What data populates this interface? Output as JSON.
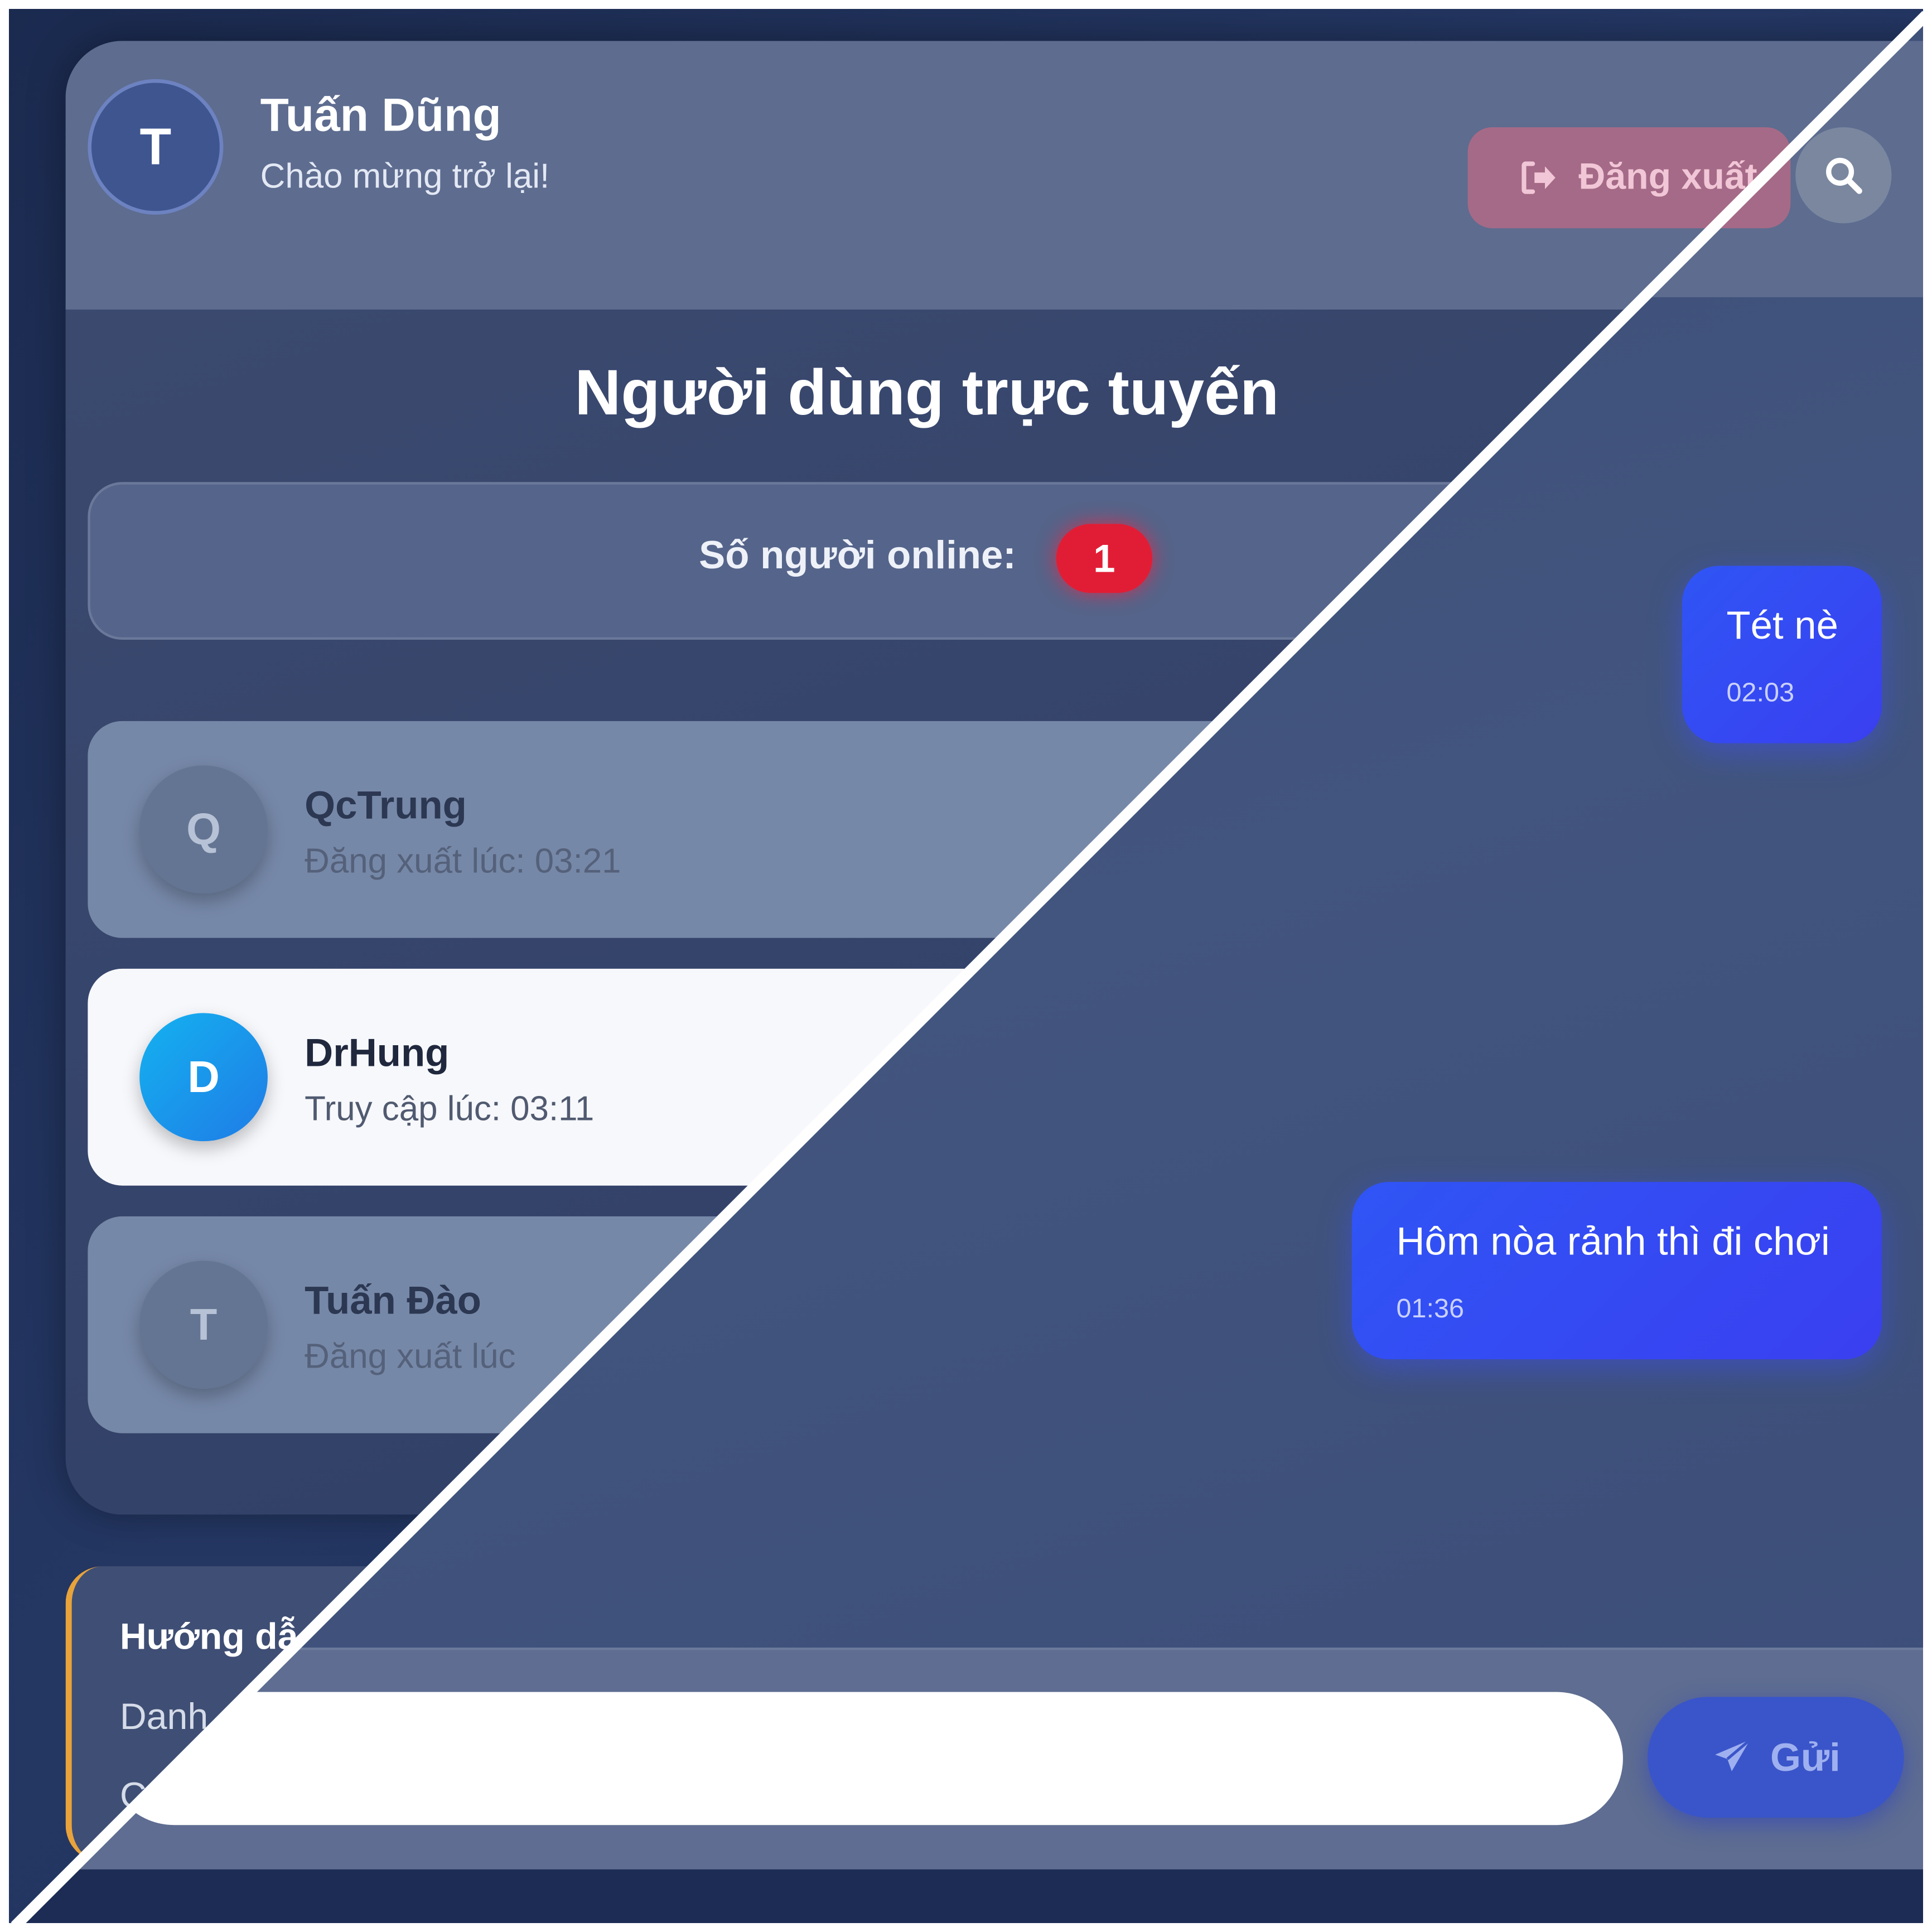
{
  "header": {
    "user_initial": "T",
    "user_name": "Tuấn Dũng",
    "greeting": "Chào mừng trở lại!",
    "logout_label": "Đăng xuất"
  },
  "online": {
    "title": "Người dùng trực tuyến",
    "count_label": "Số người online:",
    "count": "1"
  },
  "users": [
    {
      "initial": "Q",
      "name": "QcTrung",
      "status": "Đăng xuất lúc: 03:21",
      "active": false
    },
    {
      "initial": "D",
      "name": "DrHung",
      "status": "Truy cập lúc: 03:11",
      "active": true
    },
    {
      "initial": "T",
      "name": "Tuấn Đào",
      "status": "Đăng xuất lúc",
      "active": false
    }
  ],
  "guide": {
    "title": "Hướng dẫ",
    "line1": "Danh",
    "line2": "C"
  },
  "chat": {
    "messages": [
      {
        "text": "Tét nè",
        "time": "02:03"
      },
      {
        "text": "Hôm nòa rảnh thì đi chơi",
        "time": "01:36"
      }
    ],
    "input_placeholder": "",
    "send_label": "Gửi"
  },
  "colors": {
    "accent": "#3344ee",
    "online_badge": "#e11d35",
    "active_avatar": "#1a9ae8",
    "guide_border": "#e8a33b"
  }
}
